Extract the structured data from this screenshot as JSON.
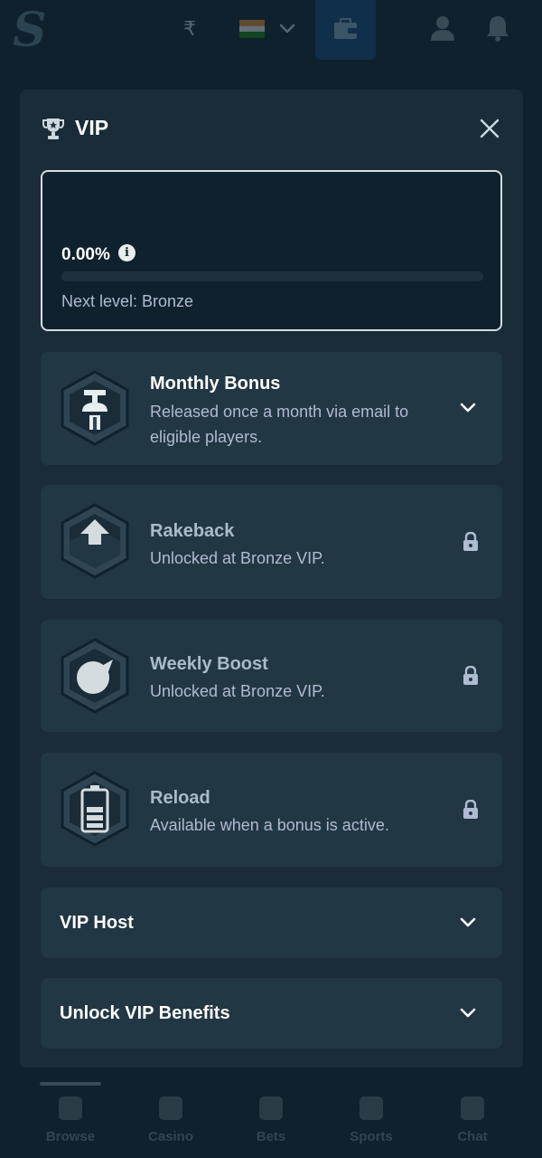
{
  "topbar": {
    "currency_symbol": "₹",
    "flag_colors": [
      "#ff9933",
      "#ffffff",
      "#138808"
    ]
  },
  "modal": {
    "title": "VIP",
    "icons": {
      "title": "trophy-icon",
      "close": "close-icon"
    }
  },
  "progress": {
    "percent_label": "0.00%",
    "percent_value": 0,
    "info_glyph": "i",
    "next_level_label": "Next level: Bronze"
  },
  "benefits": [
    {
      "title": "Monthly Bonus",
      "description": "Released once a month via email to eligible players.",
      "state": "expandable",
      "icon": "gift-icon"
    },
    {
      "title": "Rakeback",
      "description": "Unlocked at Bronze VIP.",
      "state": "locked",
      "icon": "arrow-up-icon"
    },
    {
      "title": "Weekly Boost",
      "description": "Unlocked at Bronze VIP.",
      "state": "locked",
      "icon": "boost-icon"
    },
    {
      "title": "Reload",
      "description": "Available when a bonus is active.",
      "state": "locked",
      "icon": "battery-icon"
    }
  ],
  "accordions": [
    {
      "title": "VIP Host"
    },
    {
      "title": "Unlock VIP Benefits"
    }
  ],
  "bottom_nav": [
    {
      "label": "Browse",
      "icon": "browse-icon"
    },
    {
      "label": "Casino",
      "icon": "casino-icon"
    },
    {
      "label": "Bets",
      "icon": "bets-icon"
    },
    {
      "label": "Sports",
      "icon": "sports-icon"
    },
    {
      "label": "Chat",
      "icon": "chat-icon"
    }
  ],
  "colors": {
    "background": "#0f212d",
    "panel": "#1a2c38",
    "card": "#213743",
    "accent": "#1475e1",
    "muted_text": "#b1bad3"
  }
}
